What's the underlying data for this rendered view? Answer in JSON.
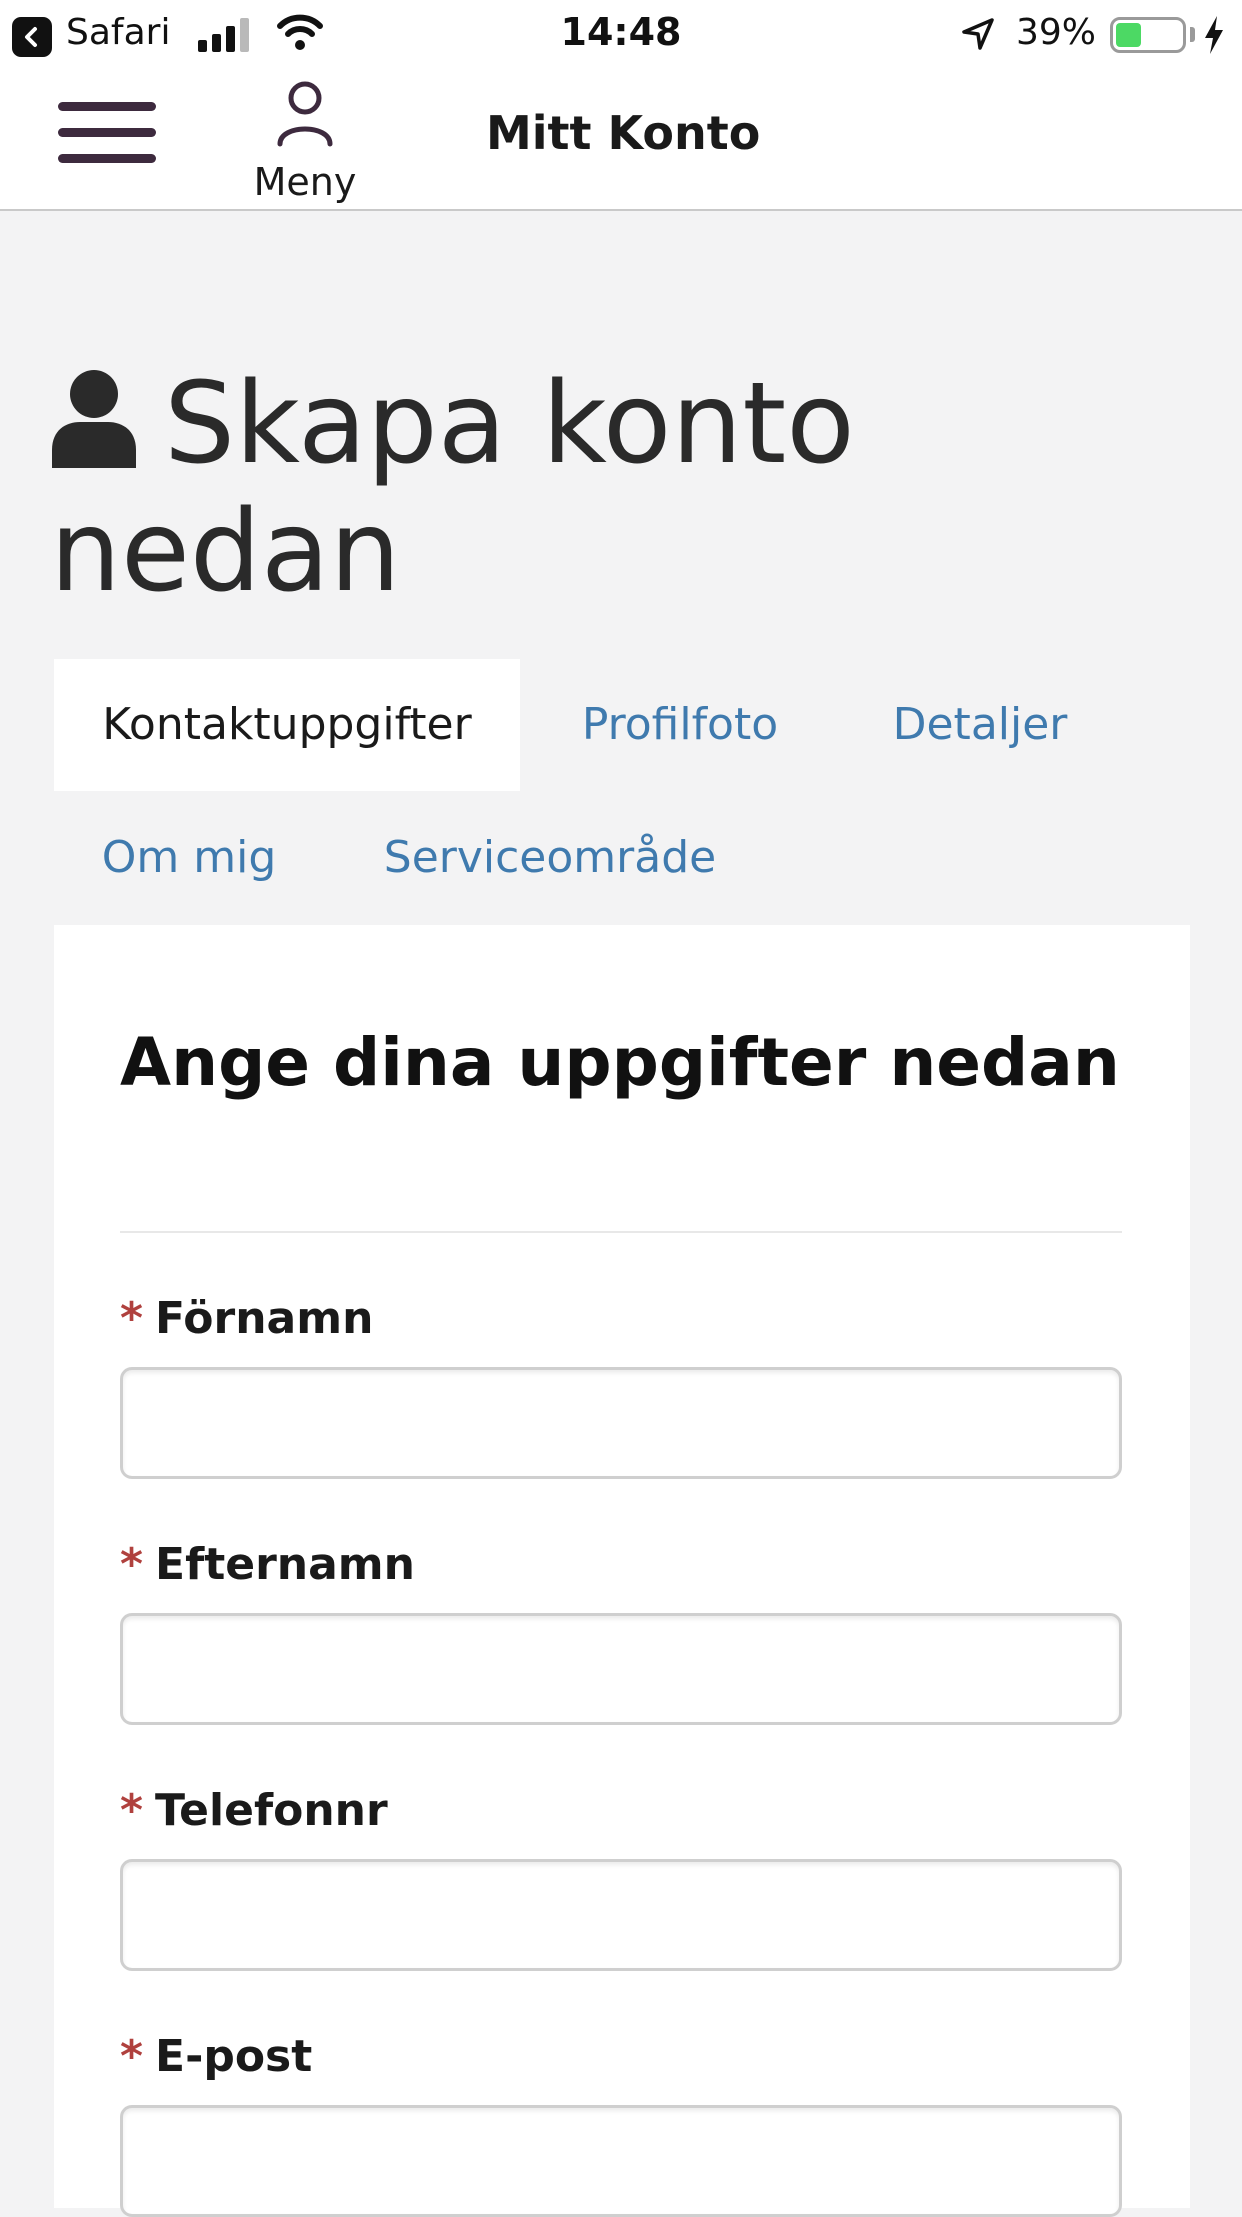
{
  "status_bar": {
    "back_app": "Safari",
    "time": "14:48",
    "battery_percent": "39%",
    "battery_level": 0.39,
    "icons": [
      "back-icon",
      "signal-icon",
      "wifi-icon",
      "location-arrow-icon",
      "battery-icon",
      "charging-bolt-icon"
    ]
  },
  "header": {
    "menu_label": "Meny",
    "title": "Mitt Konto",
    "icons": [
      "hamburger-icon",
      "user-icon"
    ],
    "accent_color": "#3d2a3e"
  },
  "page": {
    "title": "Skapa konto nedan",
    "title_icon": "user-solid-icon"
  },
  "tabs": [
    {
      "label": "Kontaktuppgifter",
      "active": true
    },
    {
      "label": "Profilfoto",
      "active": false
    },
    {
      "label": "Detaljer",
      "active": false
    },
    {
      "label": "Om mig",
      "active": false
    },
    {
      "label": "Serviceområde",
      "active": false
    }
  ],
  "form": {
    "heading": "Ange dina uppgifter nedan",
    "required_marker": "*",
    "fields": [
      {
        "label": "Förnamn",
        "value": ""
      },
      {
        "label": "Efternamn",
        "value": ""
      },
      {
        "label": "Telefonnr",
        "value": ""
      },
      {
        "label": "E-post",
        "value": ""
      }
    ]
  },
  "colors": {
    "link": "#3f7aae",
    "required": "#b0413e",
    "battery_fill": "#4cd964",
    "page_background": "#f3f3f4"
  }
}
